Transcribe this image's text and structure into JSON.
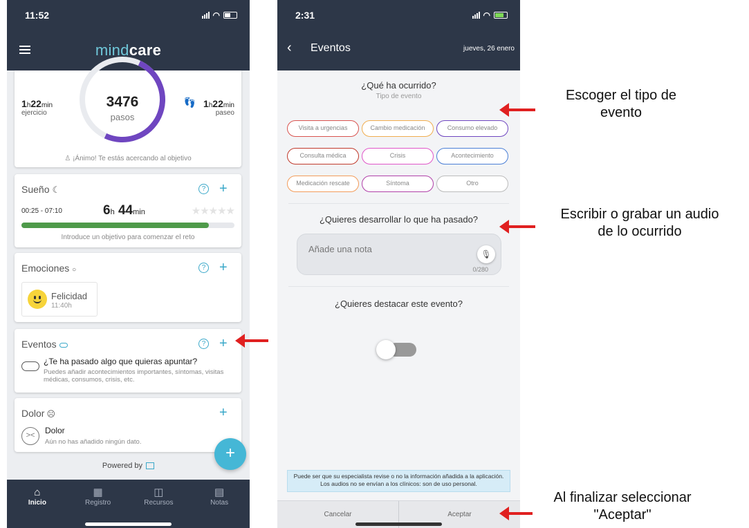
{
  "left": {
    "status_time": "11:52",
    "app_logo_part1": "mind",
    "app_logo_part2": "care",
    "activity": {
      "steps": "3476",
      "steps_label": "pasos",
      "exercise_value": "1",
      "exercise_h": "h",
      "exercise_min_value": "22",
      "exercise_min": "min",
      "exercise_label": "ejercicio",
      "walk_value": "1",
      "walk_h": "h",
      "walk_min_value": "22",
      "walk_min": "min",
      "walk_label": "paseo",
      "encourage": "¡Ánimo! Te estás acercando al objetivo",
      "progress_fraction": 0.7
    },
    "sleep": {
      "title": "Sueño",
      "range": "00:25 - 07:10",
      "hours": "6",
      "h": "h",
      "minutes": "44",
      "min": "min",
      "progress_fraction": 0.88,
      "hint": "Introduce un objetivo para comenzar el reto",
      "stars": "★★★★★"
    },
    "emotions": {
      "title": "Emociones",
      "name": "Felicidad",
      "time": "11:40h"
    },
    "events": {
      "title": "Eventos",
      "question": "¿Te ha pasado algo que quieras apuntar?",
      "description": "Puedes añadir acontecimientos importantes, síntomas, visitas médicas, consumos, crisis, etc."
    },
    "pain": {
      "title": "Dolor",
      "name": "Dolor",
      "description": "Aún no has añadido ningún dato."
    },
    "powered": "Powered by",
    "tabs": [
      {
        "label": "Inicio",
        "icon": "home-icon"
      },
      {
        "label": "Registro",
        "icon": "calendar-icon"
      },
      {
        "label": "Recursos",
        "icon": "book-icon"
      },
      {
        "label": "Notas",
        "icon": "note-icon"
      }
    ]
  },
  "right": {
    "status_time": "2:31",
    "title": "Eventos",
    "date": "jueves, 26 enero",
    "question1": "¿Qué ha ocurrido?",
    "question1_sub": "Tipo de evento",
    "chips": [
      {
        "label": "Visita a urgencias",
        "color": "#d9534f"
      },
      {
        "label": "Cambio medicación",
        "color": "#f0ad4e"
      },
      {
        "label": "Consumo elevado",
        "color": "#6f46c0"
      },
      {
        "label": "Consulta médica",
        "color": "#c0392b"
      },
      {
        "label": "Crisis",
        "color": "#e056c9"
      },
      {
        "label": "Acontecimiento",
        "color": "#4a7fd6"
      },
      {
        "label": "Medicación rescate",
        "color": "#f39c5a"
      },
      {
        "label": "Síntoma",
        "color": "#b03fa8"
      },
      {
        "label": "Otro",
        "color": "#bbbbbb"
      }
    ],
    "question2": "¿Quieres desarrollar lo que ha pasado?",
    "note_placeholder": "Añade una nota",
    "note_counter": "0/280",
    "question3": "¿Quieres destacar este evento?",
    "info": "Puede ser que su especialista revise o no la información añadida a la aplicación. Los audios no se envían a los clínicos: son de uso personal.",
    "cancel": "Cancelar",
    "accept": "Aceptar"
  },
  "annotations": {
    "type_line1": "Escoger el tipo de",
    "type_line2": "evento",
    "write_line1": "Escribir o grabar un audio",
    "write_line2": "de lo ocurrido",
    "accept_line1": "Al finalizar seleccionar",
    "accept_line2": "\"Aceptar\""
  },
  "colors": {
    "header": "#2d3748",
    "accent": "#3aa8c9",
    "arrow": "#e02020"
  }
}
